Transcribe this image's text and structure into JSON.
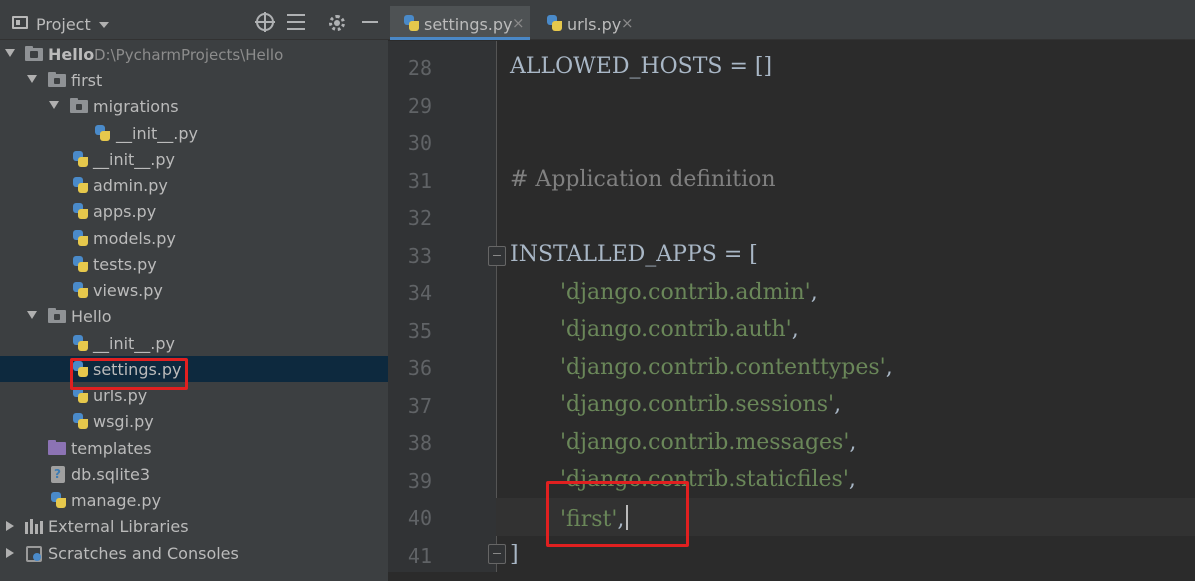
{
  "project_panel": {
    "title": "Project",
    "tree": [
      {
        "label": "Hello",
        "path": "D:\\PycharmProjects\\Hello"
      },
      {
        "label": "first"
      },
      {
        "label": "migrations"
      },
      {
        "label": "__init__.py"
      },
      {
        "label": "__init__.py"
      },
      {
        "label": "admin.py"
      },
      {
        "label": "apps.py"
      },
      {
        "label": "models.py"
      },
      {
        "label": "tests.py"
      },
      {
        "label": "views.py"
      },
      {
        "label": "Hello"
      },
      {
        "label": "__init__.py"
      },
      {
        "label": "settings.py"
      },
      {
        "label": "urls.py"
      },
      {
        "label": "wsgi.py"
      },
      {
        "label": "templates"
      },
      {
        "label": "db.sqlite3"
      },
      {
        "label": "manage.py"
      },
      {
        "label": "External Libraries"
      },
      {
        "label": "Scratches and Consoles"
      }
    ]
  },
  "tabs": [
    {
      "label": "settings.py",
      "close": "×"
    },
    {
      "label": "urls.py",
      "close": "×"
    }
  ],
  "editor": {
    "line_numbers": [
      "28",
      "29",
      "30",
      "31",
      "32",
      "33",
      "34",
      "35",
      "36",
      "37",
      "38",
      "39",
      "40",
      "41"
    ],
    "lines": {
      "l28": "ALLOWED_HOSTS = []",
      "l31": "# Application definition",
      "l33": "INSTALLED_APPS = [",
      "l34": "'django.contrib.admin'",
      "l35": "'django.contrib.auth'",
      "l36": "'django.contrib.contenttypes'",
      "l37": "'django.contrib.sessions'",
      "l38": "'django.contrib.messages'",
      "l39": "'django.contrib.staticfiles'",
      "l40": "'first'",
      "l41": "]",
      "comma": ","
    }
  },
  "colors": {
    "panel_bg": "#3c3f41",
    "editor_bg": "#2b2b2b",
    "selection": "#0d293e",
    "string": "#6a8759",
    "highlight_box": "#e02020"
  }
}
